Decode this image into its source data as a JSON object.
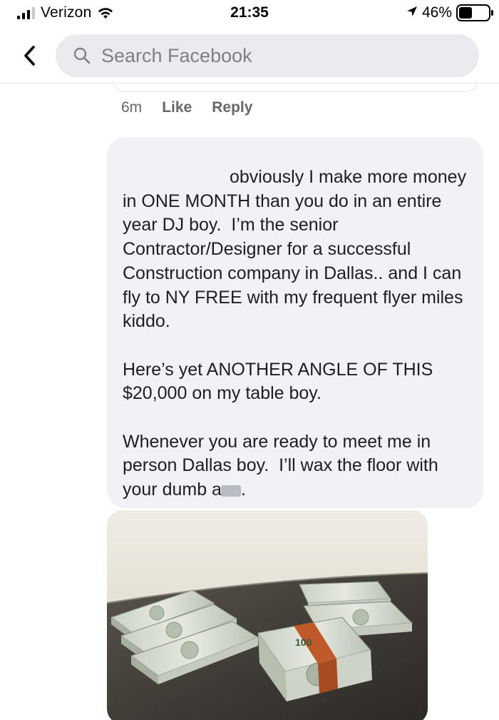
{
  "status_bar": {
    "carrier": "Verizon",
    "time": "21:35",
    "battery_percent": "46%",
    "battery_level": 0.46,
    "location_icon": "location-arrow-icon",
    "wifi_icon": "wifi-icon",
    "signal_icon": "signal-bars-icon"
  },
  "header": {
    "back_icon": "chevron-left-icon",
    "search_icon": "search-icon",
    "search_placeholder": "Search Facebook",
    "search_value": ""
  },
  "comment_actions": {
    "time": "6m",
    "like": "Like",
    "reply": "Reply"
  },
  "comment": {
    "author": "",
    "text_part1": "obviously I make more money in ONE MONTH than you do in an entire year DJ boy.  I’m the senior Contractor/Designer for a successful Construction company in Dallas.. and I can fly to NY FREE with my frequent flyer miles kiddo.\n\nHere’s yet ANOTHER ANGLE OF THIS $20,000 on my table boy.\n\nWhenever you are ready to meet me in person Dallas boy.  I’ll wax the floor with your dumb a",
    "text_end": "."
  },
  "attachment": {
    "type": "photo",
    "banknote_label": "100"
  },
  "colors": {
    "bubble": "#f0f2f5",
    "search_bg": "#e9ebee",
    "meta_text": "#65676b",
    "body_text": "#1c1e21"
  }
}
